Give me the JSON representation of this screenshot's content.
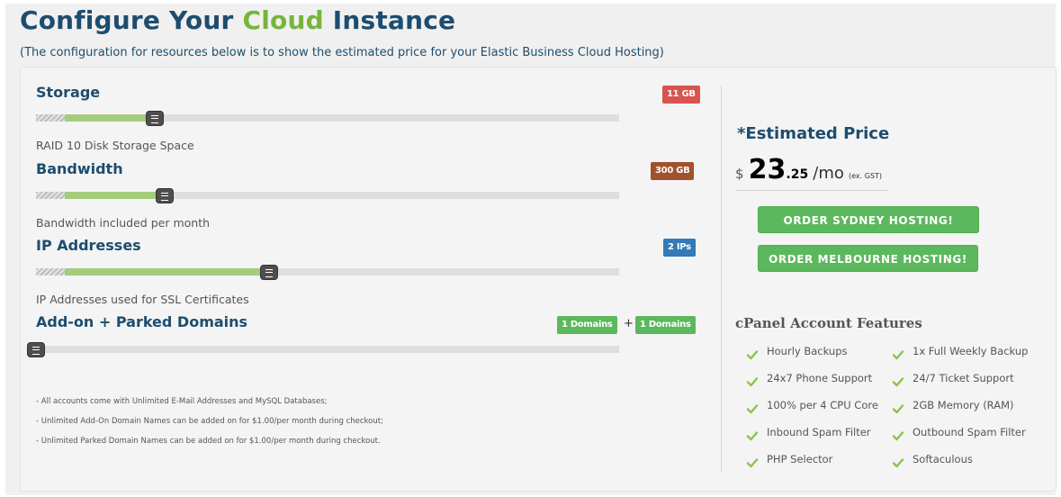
{
  "header": {
    "title_pre": "Configure Your",
    "title_highlight": "Cloud",
    "title_post": "Instance",
    "subtitle": "(The configuration for resources below is to show the estimated price for your Elastic Business Cloud Hosting)"
  },
  "sliders": [
    {
      "title": "Storage",
      "badge": "11 GB",
      "badge_color": "#d9534f",
      "description": "RAID 10 Disk Storage Space",
      "fill_percent": 16
    },
    {
      "title": "Bandwidth",
      "badge": "300 GB",
      "badge_color": "#a0522d",
      "description": "Bandwidth included per month",
      "fill_percent": 17
    },
    {
      "title": "IP Addresses",
      "badge": "2 IPs",
      "badge_color": "#337ab7",
      "description": "IP Addresses used for SSL Certificates",
      "fill_percent": 35
    },
    {
      "title": "Add-on + Parked Domains",
      "badge": "1 Domains",
      "badge2": "1 Domains",
      "plus": "+",
      "badge_color": "#5cb85c",
      "fill_percent": 0
    }
  ],
  "notes": [
    "- All accounts come with Unlimited E-Mail Addresses and MySQL Databases;",
    "- Unlimited Add-On Domain Names can be added on for $1.00/per month during checkout;",
    "- Unlimited Parked Domain Names can be added on for $1.00/per month during checkout."
  ],
  "price": {
    "heading": "*Estimated Price",
    "currency": "$",
    "integer": "23",
    "decimal": ".25",
    "period": "/mo",
    "gst": "(ex. GST)"
  },
  "buttons": {
    "sydney": "ORDER SYDNEY HOSTING!",
    "melbourne": "ORDER MELBOURNE HOSTING!"
  },
  "features": {
    "heading": "cPanel Account Features",
    "left": [
      "Hourly Backups",
      "24x7 Phone Support",
      "100% per 4 CPU Core",
      "Inbound Spam Filter",
      "PHP Selector"
    ],
    "right": [
      "1x Full Weekly Backup",
      "24/7 Ticket Support",
      "2GB Memory (RAM)",
      "Outbound Spam Filter",
      "Softaculous"
    ],
    "check_color": "#8bc34a"
  }
}
